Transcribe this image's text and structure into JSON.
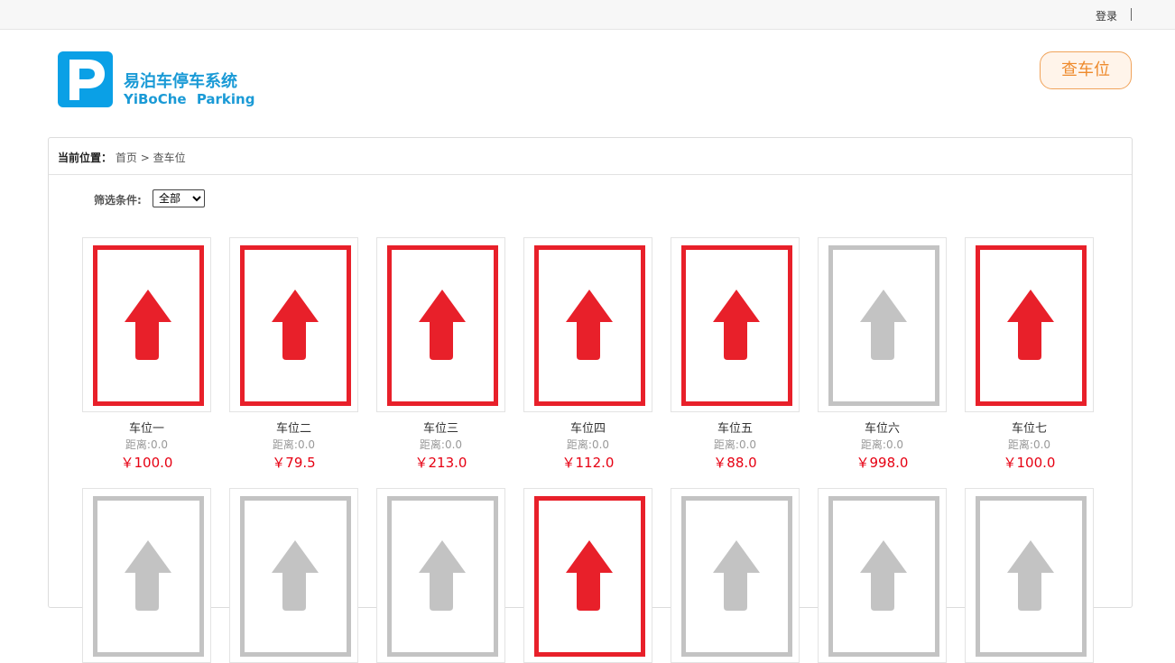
{
  "topbar": {
    "login_label": "登录"
  },
  "header": {
    "logo_letter": "P",
    "brand_cn": "易泊车停车系统",
    "brand_en": "YiBoChe Parking",
    "search_button": "查车位",
    "colors": {
      "brand": "#1a9ad6",
      "accent": "#ee8a2c"
    }
  },
  "breadcrumb": {
    "label": "当前位置：",
    "home": "首页",
    "separator": ">",
    "current": "查车位"
  },
  "filter": {
    "label": "筛选条件:",
    "selected": "全部"
  },
  "spots_row1": [
    {
      "name": "车位一",
      "distance": "距离:0.0",
      "price": "￥100.0",
      "status": "red"
    },
    {
      "name": "车位二",
      "distance": "距离:0.0",
      "price": "￥79.5",
      "status": "red"
    },
    {
      "name": "车位三",
      "distance": "距离:0.0",
      "price": "￥213.0",
      "status": "red"
    },
    {
      "name": "车位四",
      "distance": "距离:0.0",
      "price": "￥112.0",
      "status": "red"
    },
    {
      "name": "车位五",
      "distance": "距离:0.0",
      "price": "￥88.0",
      "status": "red"
    },
    {
      "name": "车位六",
      "distance": "距离:0.0",
      "price": "￥998.0",
      "status": "grey"
    },
    {
      "name": "车位七",
      "distance": "距离:0.0",
      "price": "￥100.0",
      "status": "red"
    }
  ],
  "spots_row2": [
    {
      "status": "grey"
    },
    {
      "status": "grey"
    },
    {
      "status": "grey"
    },
    {
      "status": "red"
    },
    {
      "status": "grey"
    },
    {
      "status": "grey"
    },
    {
      "status": "grey"
    }
  ],
  "status_colors": {
    "red": "#e8202a",
    "grey": "#c3c3c3"
  }
}
